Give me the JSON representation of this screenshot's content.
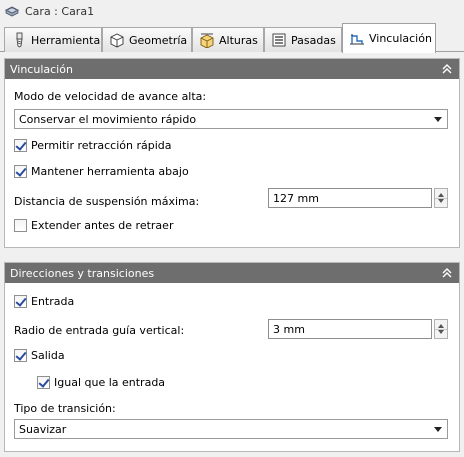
{
  "window": {
    "title": "Cara : Cara1",
    "icon": "face-icon"
  },
  "tabs": [
    {
      "label": "Herramienta",
      "icon": "tool-icon",
      "active": false
    },
    {
      "label": "Geometría",
      "icon": "cube-icon",
      "active": false
    },
    {
      "label": "Alturas",
      "icon": "heights-icon",
      "active": false
    },
    {
      "label": "Pasadas",
      "icon": "passes-icon",
      "active": false
    },
    {
      "label": "Vinculación",
      "icon": "linking-icon",
      "active": true
    }
  ],
  "linking": {
    "header": "Vinculación",
    "rapid_mode_label": "Modo de velocidad de avance alta:",
    "rapid_mode_value": "Conservar el movimiento rápido",
    "allow_rapid_retract": {
      "label": "Permitir retracción rápida",
      "checked": true
    },
    "keep_tool_down": {
      "label": "Mantener herramienta abajo",
      "checked": true
    },
    "max_stay_down_label": "Distancia de suspensión máxima:",
    "max_stay_down_value": "127 mm",
    "extend_before_retract": {
      "label": "Extender antes de retraer",
      "checked": false
    }
  },
  "transitions": {
    "header": "Direcciones y transiciones",
    "entry": {
      "label": "Entrada",
      "checked": true
    },
    "vertical_lead_radius_label": "Radio de entrada guía vertical:",
    "vertical_lead_radius_value": "3 mm",
    "exit": {
      "label": "Salida",
      "checked": true
    },
    "same_as_entry": {
      "label": "Igual que la entrada",
      "checked": true
    },
    "transition_type_label": "Tipo de transición:",
    "transition_type_value": "Suavizar"
  },
  "colors": {
    "section_header_bg": "#6e6e6e",
    "checkmark": "#2a4ba0"
  }
}
